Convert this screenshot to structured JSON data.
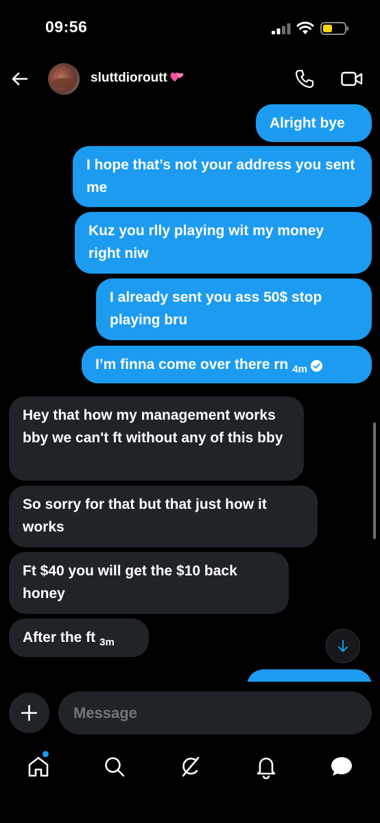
{
  "status_bar": {
    "time": "09:56"
  },
  "header": {
    "username": "sluttdioroutt"
  },
  "messages": {
    "m1": "Alright bye",
    "m2": "I hope that’s not your address you sent me",
    "m3": "Kuz you rlly playing wit my money right niw",
    "m4": "I already sent you ass 50$ stop playing bru",
    "m5": "I’m finna come over there rn",
    "m5_time": "4m",
    "m6": "Hey that how my management works bby we can't ft without any of this bby",
    "m7": "So sorry for that but that just how it works",
    "m8": "Ft $40 you will get the $10 back honey",
    "m9": "After the ft",
    "m9_time": "3m"
  },
  "composer": {
    "placeholder": "Message"
  },
  "colors": {
    "outgoing": "#1d9bf0",
    "incoming": "#202327",
    "background": "#000000"
  },
  "tabs": [
    "home-icon",
    "search-icon",
    "grok-icon",
    "notifications-icon",
    "messages-icon"
  ]
}
